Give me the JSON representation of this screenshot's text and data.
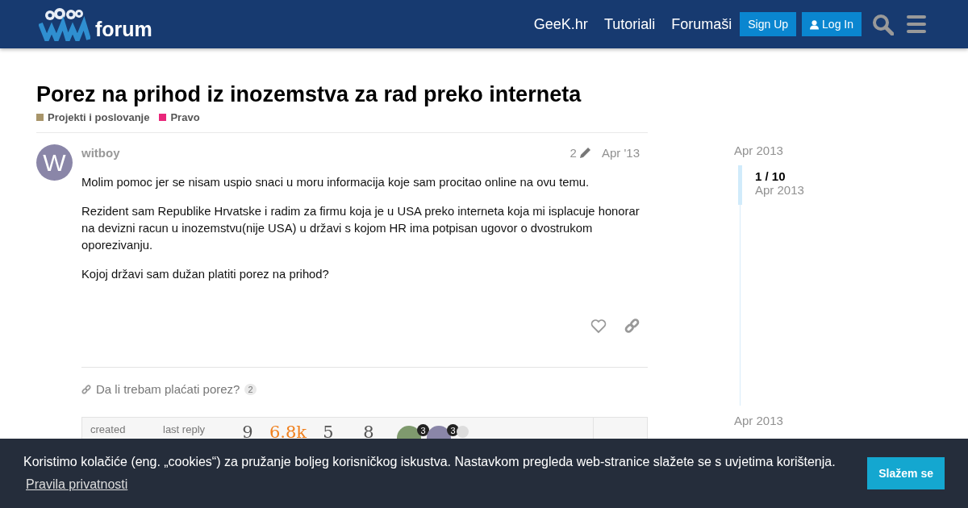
{
  "header": {
    "logo_text": "forum",
    "nav_links": [
      "GeeK.hr",
      "Tutoriali",
      "Forumaši"
    ],
    "buttons": [
      {
        "kind": "signup",
        "label": "Sign Up"
      },
      {
        "kind": "login",
        "label": "Log In"
      }
    ]
  },
  "topic": {
    "title": "Porez na prihod iz inozemstva za rad preko interneta",
    "categories": [
      {
        "name": "Projekti i poslovanje",
        "color": "#a8956a"
      },
      {
        "name": "Pravo",
        "color": "#e9277a"
      }
    ]
  },
  "post": {
    "avatar_letter": "W",
    "author": "witboy",
    "edits": "2",
    "date": "Apr '13",
    "paragraphs": [
      "Molim pomoc jer se nisam uspio snaci u moru informacija koje sam procitao online na ovu temu.",
      "Rezident sam Republike Hrvatske i radim za firmu koja je u USA preko interneta koja mi isplacuje honorar na devizni racun u inozemstvu(nije USA) u državi s kojom HR ima potpisan ugovor o dvostrukom oporezivanju.",
      "Kojoj državi sam dužan platiti porez na prihod?"
    ]
  },
  "linked_topic": {
    "title": "Da li trebam plaćati porez?",
    "clicks": "2"
  },
  "topic_map": {
    "labels": [
      "created",
      "last reply"
    ],
    "stats": [
      {
        "value": "9",
        "hot": false
      },
      {
        "value": "6.8k",
        "hot": true
      },
      {
        "value": "5",
        "hot": false
      },
      {
        "value": "8",
        "hot": false
      }
    ],
    "participants": [
      {
        "badge": "3",
        "color": "#7f9a6e"
      },
      {
        "badge": "3",
        "color": "#8a86a8"
      },
      {
        "color": "#dddddd"
      }
    ]
  },
  "timeline": {
    "start": "Apr 2013",
    "position": "1 / 10",
    "position_date": "Apr 2013",
    "end": "Apr 2013"
  },
  "cookie": {
    "message": "Koristimo kolačiće (eng. „cookies“) za pružanje boljeg korisničkog iskustva. Nastavkom pregleda web-stranice slažete se s uvjetima korištenja.",
    "link": "Pravila privatnosti",
    "button": "Slažem se"
  }
}
